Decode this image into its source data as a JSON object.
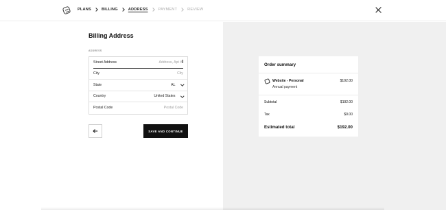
{
  "header": {
    "logo_icon": "squarespace-logo-icon",
    "steps": [
      {
        "label": "PLANS",
        "state": "done"
      },
      {
        "label": "BILLING",
        "state": "done"
      },
      {
        "label": "ADDRESS",
        "state": "active"
      },
      {
        "label": "PAYMENT",
        "state": "upcoming"
      },
      {
        "label": "REVIEW",
        "state": "upcoming"
      }
    ],
    "close_icon": "close-icon"
  },
  "form": {
    "title": "Billing Address",
    "section_label": "ADDRESS",
    "fields": {
      "street": {
        "label": "Street Address",
        "placeholder": "Address, Apt #"
      },
      "city": {
        "label": "City",
        "placeholder": "City"
      },
      "state": {
        "label": "State",
        "value": "AL"
      },
      "country": {
        "label": "Country",
        "value": "United States"
      },
      "postal": {
        "label": "Postal Code",
        "placeholder": "Postal Code"
      }
    },
    "back_icon": "arrow-left-icon",
    "save_label": "SAVE AND CONTINUE"
  },
  "summary": {
    "title": "Order summary",
    "item": {
      "name": "Website - Personal",
      "subtitle": "Annual payment",
      "price": "$192.00"
    },
    "subtotal": {
      "label": "Subtotal",
      "value": "$192.00"
    },
    "tax": {
      "label": "Tax",
      "value": "$0.00"
    },
    "total": {
      "label": "Estimated total",
      "value": "$192.00"
    }
  },
  "colors": {
    "primary_button": "#111111",
    "summary_panel_bg": "#f0f0f0"
  }
}
